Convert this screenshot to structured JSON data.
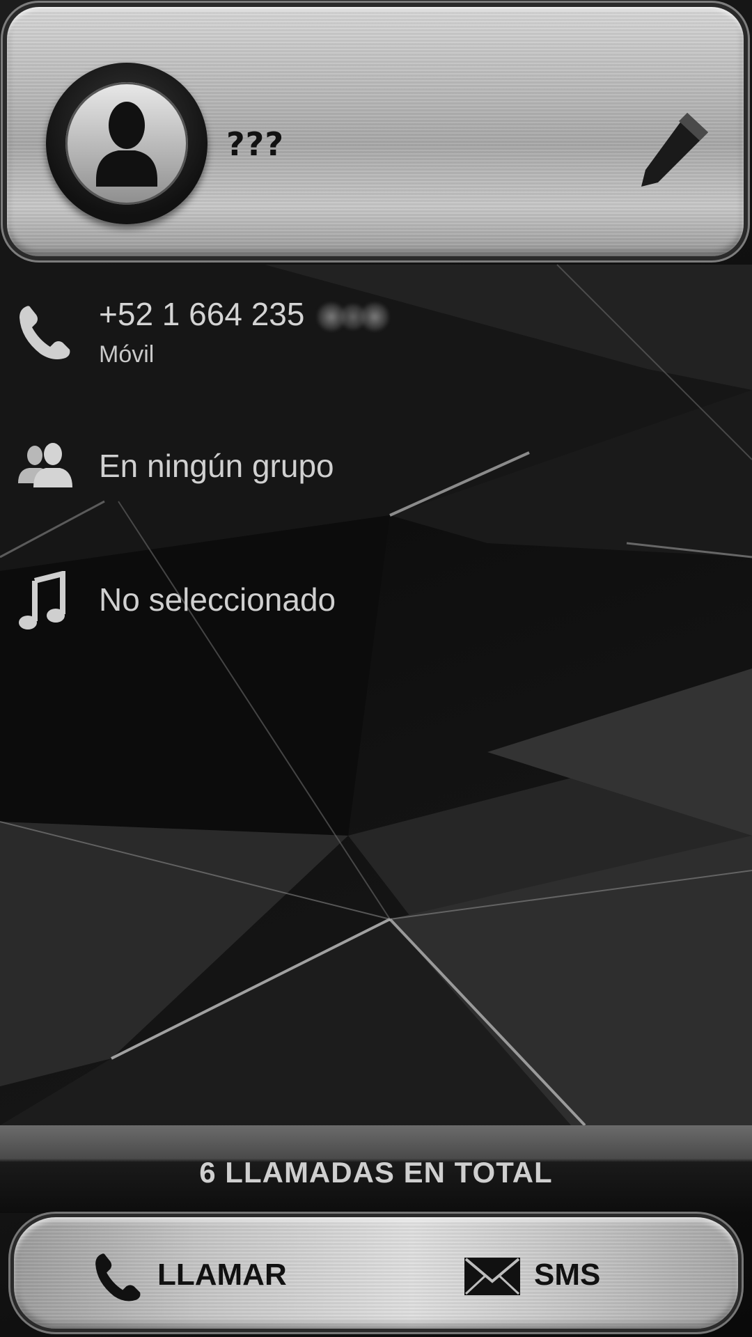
{
  "contact": {
    "name": "???",
    "avatar_icon": "person-silhouette-icon",
    "edit_icon": "pencil-icon"
  },
  "phone": {
    "icon": "phone-icon",
    "number": "+52 1 664 235",
    "type": "Móvil"
  },
  "group": {
    "icon": "group-icon",
    "label": "En ningún grupo"
  },
  "ringtone": {
    "icon": "music-note-icon",
    "label": "No seleccionado"
  },
  "calls": {
    "summary": "6 LLAMADAS EN TOTAL"
  },
  "actions": {
    "call_label": "LLAMAR",
    "call_icon": "phone-icon",
    "sms_label": "SMS",
    "sms_icon": "envelope-icon"
  },
  "colors": {
    "metal_light": "#e0e0e0",
    "metal_dark": "#9a9a9a",
    "text_light": "#d0d0d0",
    "background": "#0b0b0b"
  }
}
